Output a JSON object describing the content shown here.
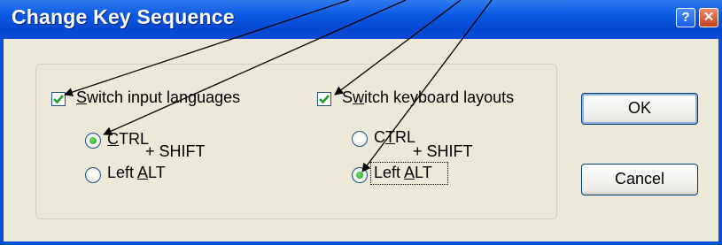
{
  "dialog": {
    "title": "Change Key Sequence"
  },
  "titlebar": {
    "help_label": "?",
    "close_label": "✕"
  },
  "input_languages": {
    "checkbox_label": "Switch input languages",
    "checked": true,
    "options": [
      {
        "label": "CTRL",
        "selected": true
      },
      {
        "label": "Left ALT",
        "selected": false
      }
    ],
    "shift_label": "+  SHIFT"
  },
  "keyboard_layouts": {
    "checkbox_label": "Switch keyboard layouts",
    "checked": true,
    "options": [
      {
        "label": "CTRL",
        "selected": false
      },
      {
        "label": "Left ALT",
        "selected": true
      }
    ],
    "shift_label": "+  SHIFT"
  },
  "buttons": {
    "ok": "OK",
    "cancel": "Cancel"
  },
  "colors": {
    "check_green": "#21a121",
    "title_blue": "#0a58e3",
    "face": "#ece9d8"
  }
}
